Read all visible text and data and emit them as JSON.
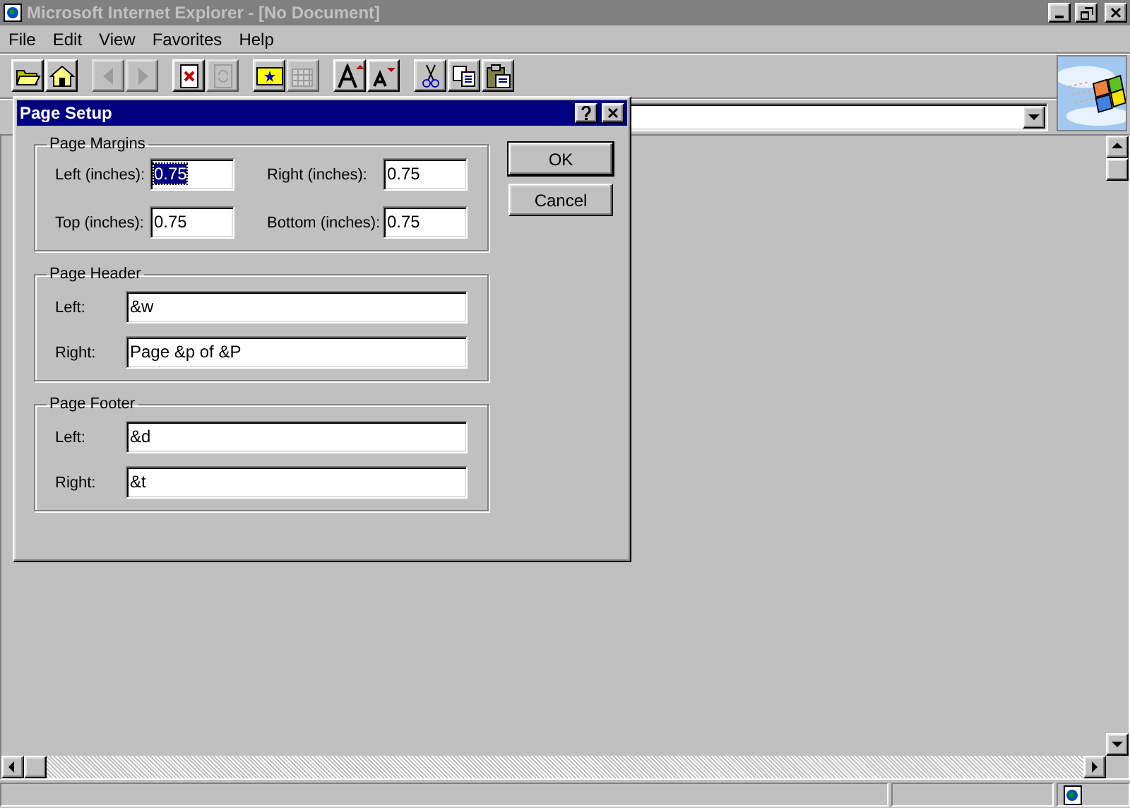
{
  "window": {
    "title": "Microsoft Internet Explorer - [No Document]",
    "active": false
  },
  "menu": [
    "File",
    "Edit",
    "View",
    "Favorites",
    "Help"
  ],
  "toolbar": [
    {
      "kind": "open",
      "disabled": false
    },
    {
      "kind": "home",
      "disabled": false
    },
    {
      "kind": "sep"
    },
    {
      "kind": "back",
      "disabled": true
    },
    {
      "kind": "forward",
      "disabled": true
    },
    {
      "kind": "sep"
    },
    {
      "kind": "stop",
      "disabled": false
    },
    {
      "kind": "refresh",
      "disabled": true
    },
    {
      "kind": "sep"
    },
    {
      "kind": "favorites",
      "disabled": false
    },
    {
      "kind": "grid",
      "disabled": true
    },
    {
      "kind": "sep"
    },
    {
      "kind": "larger",
      "disabled": false
    },
    {
      "kind": "smaller",
      "disabled": false
    },
    {
      "kind": "sep"
    },
    {
      "kind": "cut",
      "disabled": false
    },
    {
      "kind": "copy",
      "disabled": false
    },
    {
      "kind": "paste",
      "disabled": false
    }
  ],
  "dialog": {
    "title": "Page Setup",
    "active": true,
    "margins": {
      "title": "Page Margins",
      "fields": [
        {
          "label": "Left (inches):",
          "value": "0.75",
          "selected": true
        },
        {
          "label": "Right (inches):",
          "value": "0.75",
          "selected": false
        },
        {
          "label": "Top (inches):",
          "value": "0.75",
          "selected": false
        },
        {
          "label": "Bottom (inches):",
          "value": "0.75",
          "selected": false
        }
      ]
    },
    "groups": [
      {
        "title": "Page Header",
        "fields": [
          {
            "label": "Left:",
            "value": "&w"
          },
          {
            "label": "Right:",
            "value": "Page &p of &P"
          }
        ]
      },
      {
        "title": "Page Footer",
        "fields": [
          {
            "label": "Left:",
            "value": "&d"
          },
          {
            "label": "Right:",
            "value": "&t"
          }
        ]
      }
    ],
    "buttons": [
      {
        "label": "OK",
        "default": true
      },
      {
        "label": "Cancel",
        "default": false
      }
    ]
  }
}
